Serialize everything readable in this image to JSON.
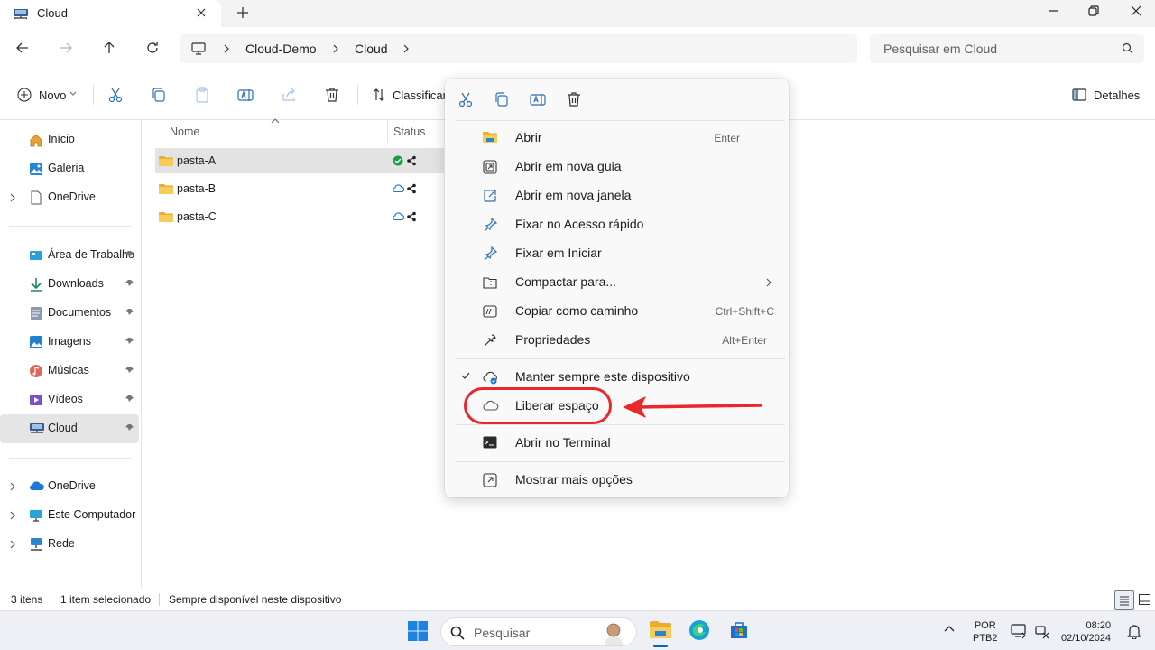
{
  "window": {
    "tab_title": "Cloud",
    "tab_icon": "network-folder-icon"
  },
  "address": {
    "crumbs": [
      "Cloud-Demo",
      "Cloud"
    ],
    "search_placeholder": "Pesquisar em Cloud"
  },
  "toolbar": {
    "new_label": "Novo",
    "sort_label": "Classificar",
    "details_label": "Detalhes"
  },
  "sidebar": {
    "items": [
      {
        "label": "Início",
        "icon": "home-icon"
      },
      {
        "label": "Galeria",
        "icon": "gallery-icon"
      },
      {
        "label": "OneDrive",
        "icon": "onedrive-file-icon"
      },
      {
        "label": "Área de Trabalho",
        "icon": "desktop-icon"
      },
      {
        "label": "Downloads",
        "icon": "download-icon"
      },
      {
        "label": "Documentos",
        "icon": "documents-icon"
      },
      {
        "label": "Imagens",
        "icon": "pictures-icon"
      },
      {
        "label": "Músicas",
        "icon": "music-icon"
      },
      {
        "label": "Vídeos",
        "icon": "videos-icon"
      },
      {
        "label": "Cloud",
        "icon": "network-folder-icon"
      },
      {
        "label": "OneDrive",
        "icon": "onedrive-cloud-icon"
      },
      {
        "label": "Este Computador",
        "icon": "computer-icon"
      },
      {
        "label": "Rede",
        "icon": "network-icon"
      }
    ]
  },
  "filelist": {
    "col_name": "Nome",
    "col_status": "Status",
    "files": [
      {
        "name": "pasta-A",
        "status": "always-available"
      },
      {
        "name": "pasta-B",
        "status": "online-only"
      },
      {
        "name": "pasta-C",
        "status": "online-only"
      }
    ]
  },
  "statusbar": {
    "count": "3 itens",
    "selected": "1 item selecionado",
    "availability": "Sempre disponível neste dispositivo"
  },
  "context_menu": {
    "items": [
      {
        "label": "Abrir",
        "shortcut": "Enter",
        "icon": "folder-icon"
      },
      {
        "label": "Abrir em nova guia",
        "shortcut": "",
        "icon": "open-new-tab-icon"
      },
      {
        "label": "Abrir em nova janela",
        "shortcut": "",
        "icon": "open-new-window-icon"
      },
      {
        "label": "Fixar no Acesso rápido",
        "shortcut": "",
        "icon": "pin-icon"
      },
      {
        "label": "Fixar em Iniciar",
        "shortcut": "",
        "icon": "pin-icon"
      },
      {
        "label": "Compactar para...",
        "shortcut": "",
        "icon": "zip-icon"
      },
      {
        "label": "Copiar como caminho",
        "shortcut": "Ctrl+Shift+C",
        "icon": "copy-path-icon"
      },
      {
        "label": "Propriedades",
        "shortcut": "Alt+Enter",
        "icon": "wrench-icon"
      },
      {
        "label": "Manter sempre este dispositivo",
        "shortcut": "",
        "icon": "cloud-sync-icon"
      },
      {
        "label": "Liberar espaço",
        "shortcut": "",
        "icon": "cloud-icon"
      },
      {
        "label": "Abrir no Terminal",
        "shortcut": "",
        "icon": "terminal-icon"
      },
      {
        "label": "Mostrar mais opções",
        "shortcut": "",
        "icon": "more-options-icon"
      }
    ]
  },
  "taskbar": {
    "search_placeholder": "Pesquisar",
    "lang_line1": "POR",
    "lang_line2": "PTB2",
    "time": "08:20",
    "date": "02/10/2024"
  },
  "colors": {
    "accent": "#0067c0",
    "annotation": "#e8282c",
    "folder": "#f4c542"
  }
}
